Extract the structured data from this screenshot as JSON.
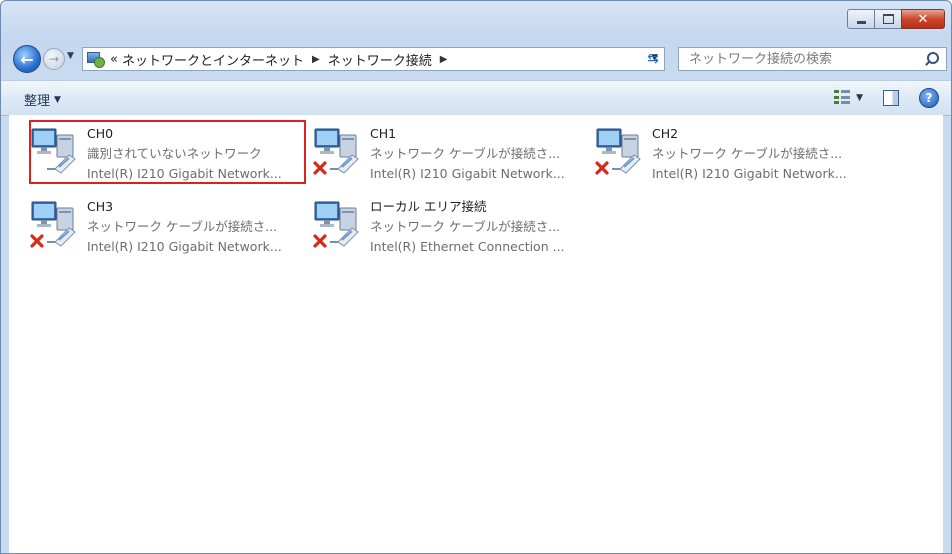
{
  "window": {
    "caption_buttons": [
      "minimize",
      "maximize",
      "close"
    ]
  },
  "address_bar": {
    "overflow_glyph": "«",
    "breadcrumbs": [
      "ネットワークとインターネット",
      "ネットワーク接続"
    ],
    "search_placeholder": "ネットワーク接続の検索"
  },
  "toolbar": {
    "organize_label": "整理"
  },
  "connections": [
    {
      "name": "CH0",
      "status": "識別されていないネットワーク",
      "device": "Intel(R) I210 Gigabit Network...",
      "disconnected": false,
      "highlighted": true
    },
    {
      "name": "CH1",
      "status": "ネットワーク ケーブルが接続さ...",
      "device": "Intel(R) I210 Gigabit Network...",
      "disconnected": true,
      "highlighted": false
    },
    {
      "name": "CH2",
      "status": "ネットワーク ケーブルが接続さ...",
      "device": "Intel(R) I210 Gigabit Network...",
      "disconnected": true,
      "highlighted": false
    },
    {
      "name": "CH3",
      "status": "ネットワーク ケーブルが接続さ...",
      "device": "Intel(R) I210 Gigabit Network...",
      "disconnected": true,
      "highlighted": false
    },
    {
      "name": "ローカル エリア接続",
      "status": "ネットワーク ケーブルが接続さ...",
      "device": "Intel(R) Ethernet Connection ...",
      "disconnected": true,
      "highlighted": false
    }
  ],
  "colors": {
    "highlight_border": "#e01f1f",
    "disconnected_x": "#d42a1a",
    "secondary_text": "#6d6d6d"
  }
}
